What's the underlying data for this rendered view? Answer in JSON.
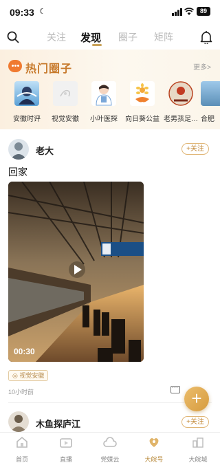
{
  "status": {
    "time": "09:33",
    "battery": "89"
  },
  "nav": {
    "tabs": [
      {
        "label": "关注",
        "active": false
      },
      {
        "label": "发现",
        "active": true
      },
      {
        "label": "圈子",
        "active": false
      },
      {
        "label": "矩阵",
        "active": false
      }
    ]
  },
  "hot": {
    "title": "热门圈子",
    "more": "更多>",
    "circles": [
      {
        "label": "安徽时评",
        "icon": "anhui-shiping-thumb"
      },
      {
        "label": "视觉安徽",
        "icon": "shijue-anhui-thumb"
      },
      {
        "label": "小叶医探",
        "icon": "xiaoye-yitan-thumb"
      },
      {
        "label": "向日葵公益",
        "icon": "sunflower-charity-thumb"
      },
      {
        "label": "老男孩足…",
        "icon": "old-boys-football-thumb"
      },
      {
        "label": "合肥",
        "icon": "hefei-thumb"
      }
    ]
  },
  "post1": {
    "author": "老大",
    "follow": "+关注",
    "text": "回家",
    "video_duration": "00:30",
    "tag": "视觉安徽",
    "time_ago": "10小时前"
  },
  "post2": {
    "author": "木鱼探庐江",
    "follow": "+关注"
  },
  "bottom": {
    "tabs": [
      {
        "label": "首页",
        "active": false
      },
      {
        "label": "直播",
        "active": false
      },
      {
        "label": "党媒云",
        "active": false
      },
      {
        "label": "大皖号",
        "active": true
      },
      {
        "label": "大皖城",
        "active": false
      }
    ]
  },
  "colors": {
    "accent": "#c9a25a",
    "hot_title": "#c77a2c",
    "fab": "#dda14a"
  }
}
